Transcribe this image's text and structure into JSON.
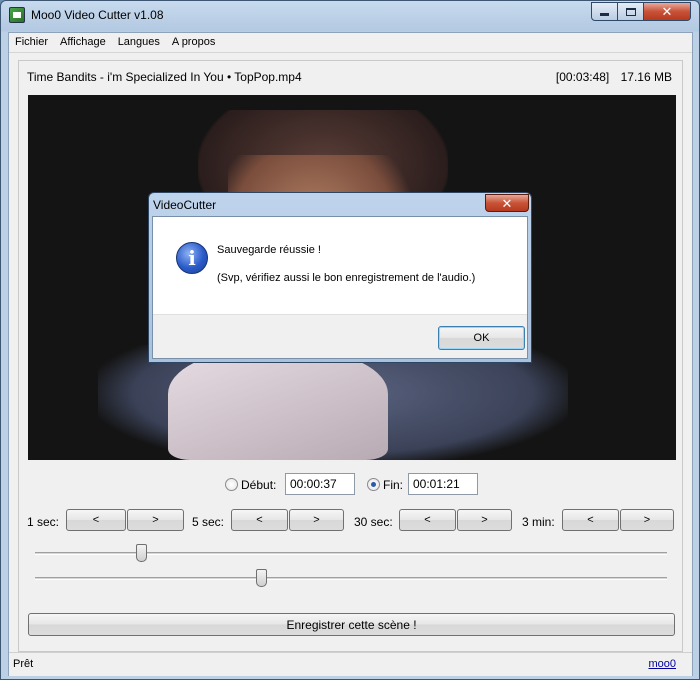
{
  "window": {
    "title": "Moo0 Video Cutter v1.08"
  },
  "menu": [
    "Fichier",
    "Affichage",
    "Langues",
    "A propos"
  ],
  "file": {
    "name": "Time Bandits - i'm Specialized In You • TopPop.mp4",
    "duration": "[00:03:48]",
    "size": "17.16 MB"
  },
  "range": {
    "start_label": "Début:",
    "start_value": "00:00:37",
    "start_selected": false,
    "end_label": "Fin:",
    "end_value": "00:01:21",
    "end_selected": true
  },
  "steps": [
    {
      "label": "1 sec:",
      "back": "<",
      "forward": ">"
    },
    {
      "label": "5 sec:",
      "back": "<",
      "forward": ">"
    },
    {
      "label": "30 sec:",
      "back": "<",
      "forward": ">"
    },
    {
      "label": "3 min:",
      "back": "<",
      "forward": ">"
    }
  ],
  "sliders": {
    "start_fraction": 0.168,
    "end_fraction": 0.358
  },
  "save_button": "Enregistrer cette scène !",
  "status": {
    "text": "Prêt",
    "link": "moo0"
  },
  "dialog": {
    "title": "VideoCutter",
    "message": "Sauvegarde réussie !",
    "detail": "(Svp, vérifiez aussi le bon enregistrement de l'audio.)",
    "ok": "OK",
    "icon": "info-icon"
  }
}
